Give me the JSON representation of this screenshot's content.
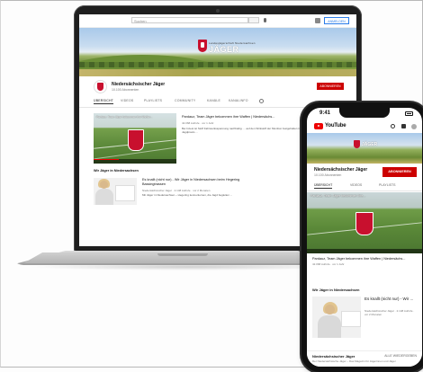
{
  "laptop": {
    "search_placeholder": "Suchen",
    "signin_label": "ANMELDEN",
    "logo_small": "Landesjägerschaft Niedersachsen",
    "logo_big": "JÄGER",
    "channel_name": "Niedersächsischer Jäger",
    "channel_subs": "10.100 Abonnenten",
    "subscribe_label": "ABONNIEREN",
    "tabs": [
      "ÜBERSICHT",
      "VIDEOS",
      "PLAYLISTS",
      "COMMUNITY",
      "KANÄLE",
      "KANALINFO"
    ],
    "featured": {
      "overlay_title": "Pardauz, Team Jäger bekommen ihre Waffen...",
      "title": "Pardauz, Team Jäger bekommen ihre Waffen | Niedersächs...",
      "meta": "42.068 Aufrufe · vor 1 Jahr",
      "description": "Bei Inzest ist Stoff Fahrwerksspannung nachhaltig. ... auf den Wirkstoff der Munition festgehalten in der Jagdpraxis ..."
    },
    "section_title": "Wir Jäger in Niedersachsen",
    "card": {
      "title": "Es knallt (nicht nur) - Wir Jäger in Niedersachsen beim Hegering Bassingtrassen",
      "meta": "Niedersächsischer Jäger · 2.148 Aufrufe · vor 2 Monaten",
      "description": "Mit Jäger in Niedersachsen – Hegering kennenlernen, die Jagd begleiten ..."
    }
  },
  "phone": {
    "time": "9:41",
    "yt_label": "YouTube",
    "banner_text": "JÄGER",
    "channel_name": "Niedersächsischer Jäger",
    "channel_subs": "10.100 Abonnenten",
    "subscribe_label": "ABONNIEREN",
    "tabs": [
      "ÜBERSICHT",
      "VIDEOS",
      "PLAYLISTS"
    ],
    "video": {
      "overlay_title": "Pardauz, Team Jäger bekommen ihre...",
      "title": "Pardauz, Team Jäger bekommen ihre Waffen | Niedersächs...",
      "meta": "42.068 Aufrufe · vor 1 Jahr"
    },
    "section_title": "Wir Jäger in Niedersachsen",
    "card": {
      "title": "Es knallt (nicht nur) - Wir ...",
      "meta": "Niedersächsischer Jäger · 2.148 Aufrufe · vor 2 Monaten"
    },
    "bottom": {
      "name": "Niedersächsischer Jäger",
      "description": "Der Niedersächsische Jäger – Das Magazin für Jägerinnen und Jäger",
      "play_all": "ALLE WIEDERGEBEN"
    }
  },
  "colors": {
    "subscribe_red": "#cc0000",
    "brand_red": "#c8102e"
  }
}
